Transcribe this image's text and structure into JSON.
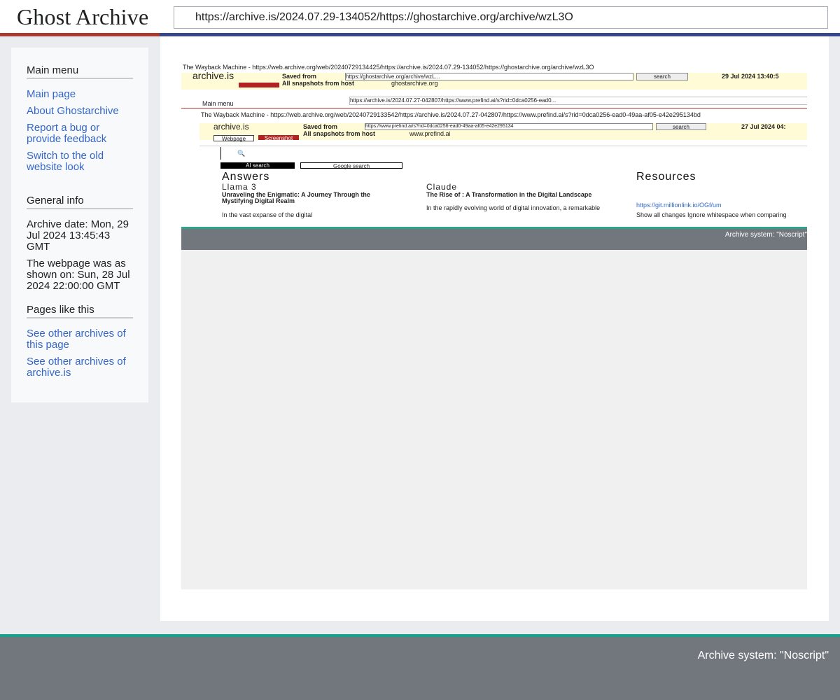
{
  "header": {
    "logo": "Ghost Archive",
    "url": "https://archive.is/2024.07.29-134052/https://ghostarchive.org/archive/wzL3O"
  },
  "sidebar": {
    "main_menu": {
      "title": "Main menu",
      "items": [
        "Main page",
        "About Ghostarchive",
        "Report a bug or provide feedback",
        "Switch to the old website look"
      ]
    },
    "general_info": {
      "title": "General info",
      "archive_date": "Archive date: Mon, 29 Jul 2024 13:45:43 GMT",
      "shown_on": "The webpage was as shown on: Sun, 28 Jul 2024 22:00:00 GMT"
    },
    "pages_like_this": {
      "title": "Pages like this",
      "items": [
        "See other archives of this page",
        "See other archives of archive.is"
      ]
    }
  },
  "snapshot": {
    "wayback_line_1": "The Wayback Machine - https://web.archive.org/web/20240729134425/https://archive.is/2024.07.29-134052/https://ghostarchive.org/archive/wzL3O",
    "archive_logo_1": "archive.is",
    "saved_from_label_1": "Saved from",
    "saved_from_url_1": "https://ghostarchive.org/archive/wzL...",
    "search_btn_1": "search",
    "date_1": "29 Jul 2024 13:40:5",
    "all_snapshots_1": "All snapshots from host",
    "host_1": "ghostarchive.org",
    "inner_url": "https://archive.is/2024.07.27-042807/https://www.prefind.ai/s?rid=0dca0256-ead0...",
    "main_menu_label": "Main menu",
    "wayback_line_2": "The Wayback Machine - https://web.archive.org/web/20240729133542/https://archive.is/2024.07.27-042807/https://www.prefind.ai/s?rid=0dca0256-ead0-49aa-af05-e42e295134bd",
    "archive_logo_2": "archive.is",
    "saved_from_label_2": "Saved from",
    "saved_from_url_2": "https://www.prefind.ai/s?rid=0dca0256-ead0-49aa-af05-e42e295134",
    "search_btn_2": "search",
    "date_2": "27 Jul 2024 04:",
    "all_snapshots_2": "All snapshots from host",
    "host_2": "www.prefind.ai",
    "webpage_tab": "Webpage",
    "screenshot_tab": "Screenshot",
    "ai_search": "AI search",
    "google_search": "Google search",
    "answers_title": "Answers",
    "llama_label": "Llama 3",
    "llama_headline": "Unraveling the Enigmatic: A Journey Through the Mystifying Digital Realm",
    "llama_snippet": "In the vast expanse of the digital",
    "claude_label": "Claude",
    "claude_headline": "The Rise of : A Transformation in the Digital Landscape",
    "claude_snippet": "In the rapidly evolving world of digital innovation, a remarkable",
    "resources_title": "Resources",
    "resources_link": "https://git.millionlink.io/OGf/um",
    "ignore_ws": "Show all changes   Ignore whitespace when comparing",
    "footer_text": "Archive system: \"Noscript\""
  },
  "footer": {
    "text": "Archive system: \"Noscript\""
  }
}
